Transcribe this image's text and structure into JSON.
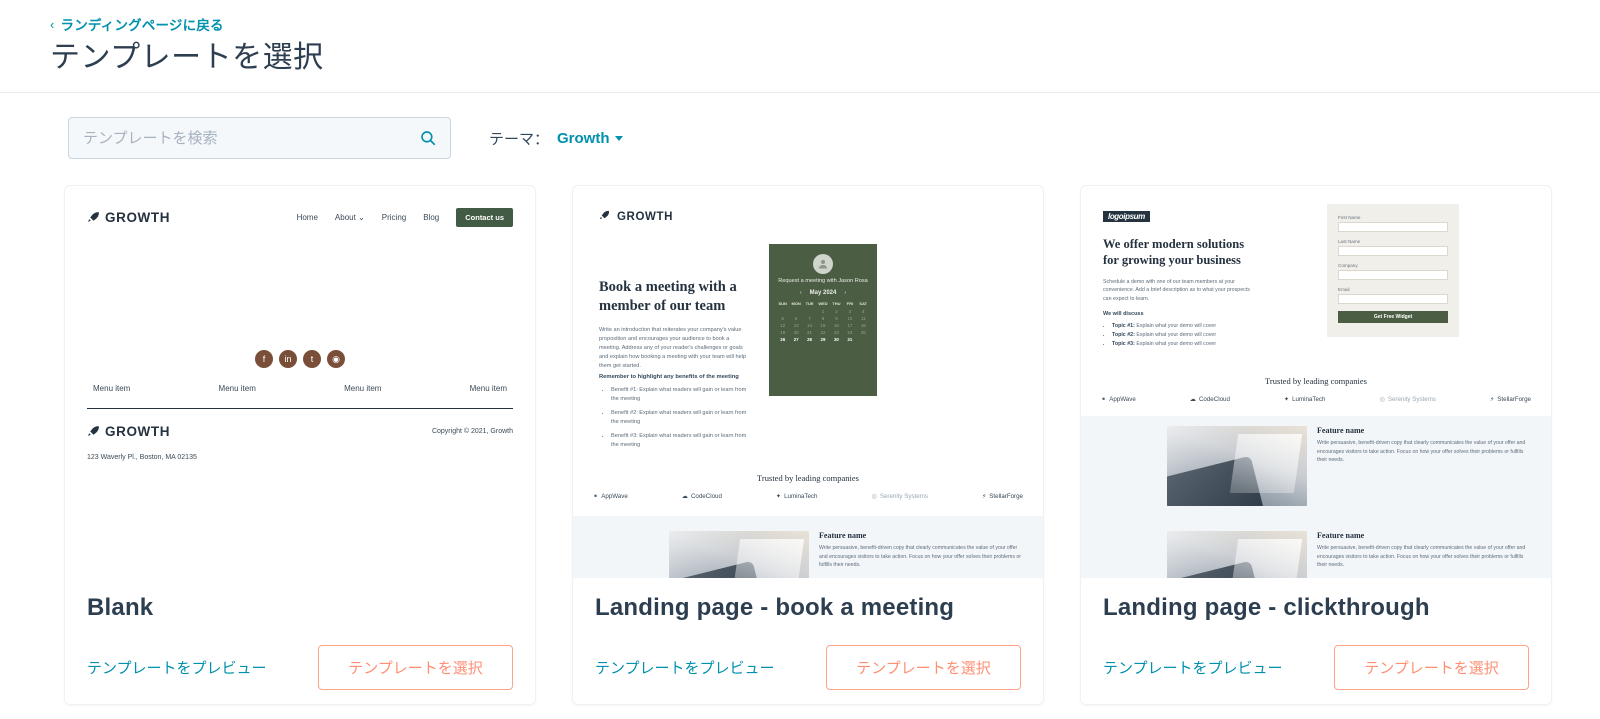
{
  "header": {
    "back_link": "ランディングページに戻る",
    "back_chevron": "chevron-left-icon",
    "title": "テンプレートを選択"
  },
  "toolbar": {
    "search_placeholder": "テンプレートを検索",
    "search_value": "",
    "search_icon": "search-icon",
    "theme_label": "テーマ：",
    "theme_value": "Growth",
    "theme_caret": "chevron-down-icon"
  },
  "actions": {
    "preview_label": "テンプレートをプレビュー",
    "select_label": "テンプレートを選択",
    "accent_orange": "#ff8f73",
    "accent_teal": "#0091ae",
    "title_color": "#2d3e50"
  },
  "templates": [
    {
      "title": "Blank"
    },
    {
      "title": "Landing page - book a meeting"
    },
    {
      "title": "Landing page - clickthrough"
    }
  ],
  "preview1": {
    "brand": "GROWTH",
    "nav": [
      "Home",
      "About",
      "Pricing",
      "Blog"
    ],
    "nav_caret": "chevron-down-icon",
    "cta": "Contact us",
    "cta_color": "#425b45",
    "social": [
      "facebook-icon",
      "linkedin-icon",
      "twitter-icon",
      "instagram-icon"
    ],
    "social_glyphs": [
      "f",
      "in",
      "t",
      "◉"
    ],
    "social_color": "#7a4f3a",
    "menu_items": [
      "Menu item",
      "Menu item",
      "Menu item",
      "Menu item"
    ],
    "copyright": "Copyright © 2021, Growth",
    "address": "123 Waverly Pl., Boston, MA 02135"
  },
  "preview2": {
    "brand": "GROWTH",
    "heading": "Book a meeting with a member of our team",
    "body": "Write an introduction that reiterates your company's value proposition and encourages your audience to book a meeting. Address any of your reader's challenges or goals and explain how booking a meeting with your team will help them get started.",
    "bullets_title": "Remember to highlight any benefits of the meeting",
    "bullets": [
      "Benefit #1: Explain what readers will gain or learn from the meeting",
      "Benefit #2: Explain what readers will gain or learn from the meeting",
      "Benefit #3: Explain what readers will gain or learn from the meeting"
    ],
    "calendar": {
      "title": "Request a meeting with Jason Rosa",
      "month": "May 2024",
      "prev": "‹",
      "next": "›",
      "dow": [
        "SUN",
        "MON",
        "TUE",
        "WED",
        "THU",
        "FRI",
        "SAT"
      ],
      "avatar": "user-avatar-icon",
      "weeks": [
        [
          "",
          "",
          "",
          "1",
          "2",
          "3",
          "4"
        ],
        [
          "5",
          "6",
          "7",
          "8",
          "9",
          "10",
          "11"
        ],
        [
          "12",
          "13",
          "14",
          "15",
          "16",
          "17",
          "18"
        ],
        [
          "19",
          "20",
          "21",
          "22",
          "23",
          "24",
          "25"
        ],
        [
          "26",
          "27",
          "28",
          "29",
          "30",
          "31",
          ""
        ]
      ],
      "enabled_week_index": 4,
      "bg_color": "#4b5d42"
    },
    "trusted_title": "Trusted by leading companies",
    "logos": [
      "AppWave",
      "CodeCloud",
      "LuminaTech",
      "Serenity Systems",
      "StellarForge"
    ],
    "feature": {
      "title": "Feature name",
      "body": "Write persuasive, benefit-driven copy that clearly communicates the value of your offer and encourages visitors to take action. Focus on how your offer solves their problems or fulfills their needs.",
      "image": "hands-on-blueprint-photo"
    }
  },
  "preview3": {
    "brand": "logoipsum",
    "heading": "We offer modern solutions for growing your business",
    "body": "Schedule a demo with one of our team members at your convenience. Add a brief description as to what your prospects can expect to learn.",
    "list_title": "We will discuss",
    "list": [
      {
        "topic": "Topic #1:",
        "text": "Explain what your demo will cover"
      },
      {
        "topic": "Topic #2:",
        "text": "Explain what your demo will cover"
      },
      {
        "topic": "Topic #3:",
        "text": "Explain what your demo will cover"
      }
    ],
    "form": {
      "fields": [
        "First Name",
        "Last Name",
        "Company",
        "Email"
      ],
      "submit": "Get Free Widget",
      "submit_color": "#4b5d42",
      "bg_color": "#f1efe9"
    },
    "trusted_title": "Trusted by leading companies",
    "logos": [
      "AppWave",
      "CodeCloud",
      "LuminaTech",
      "Serenity Systems",
      "StellarForge"
    ],
    "features": [
      {
        "title": "Feature name",
        "body": "Write persuasive, benefit-driven copy that clearly communicates the value of your offer and encourages visitors to take action. Focus on how your offer solves their problems or fulfills their needs.",
        "image": "hands-on-blueprint-photo"
      },
      {
        "title": "Feature name",
        "body": "Write persuasive, benefit-driven copy that clearly communicates the value of your offer and encourages visitors to take action. Focus on how your offer solves their problems or fulfills their needs.",
        "image": "hands-on-blueprint-photo"
      }
    ]
  }
}
